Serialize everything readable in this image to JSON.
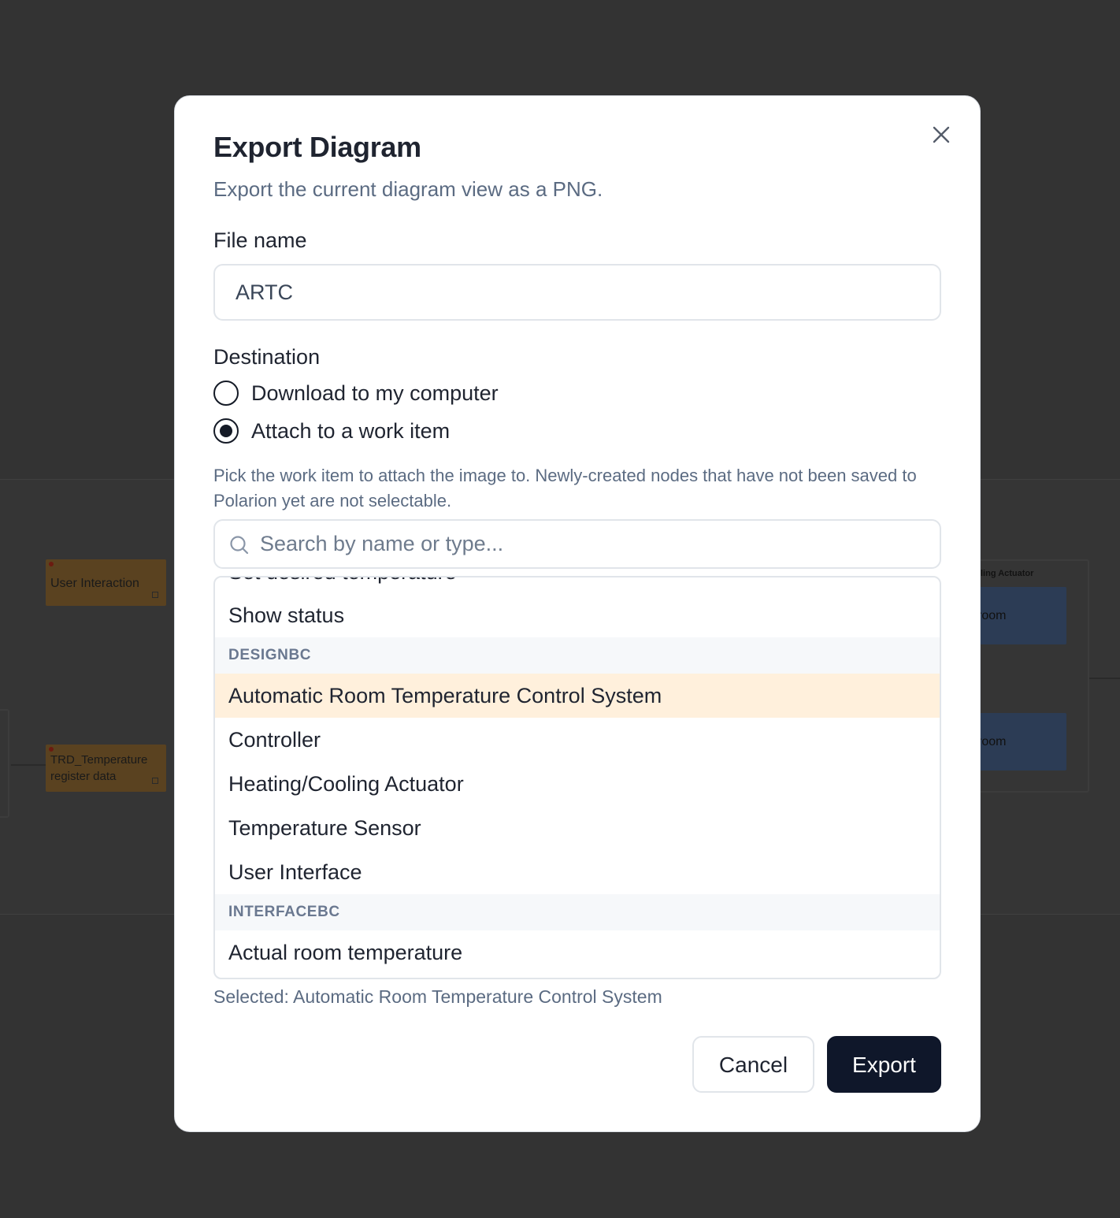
{
  "background": {
    "nodes": [
      {
        "label": "User Interaction"
      },
      {
        "label": "TRD_Temperature register data"
      }
    ],
    "frame_label": "ling Actuator",
    "blue_nodes": [
      "room",
      "room"
    ]
  },
  "dialog": {
    "title": "Export Diagram",
    "subtitle": "Export the current diagram view as a PNG.",
    "file_name_label": "File name",
    "file_name_value": "ARTC",
    "destination_label": "Destination",
    "options": [
      {
        "label": "Download to my computer",
        "checked": false
      },
      {
        "label": "Attach to a work item",
        "checked": true
      }
    ],
    "help_text": "Pick the work item to attach the image to. Newly-created nodes that have not been saved to Polarion yet are not selectable.",
    "search_placeholder": "Search by name or type...",
    "list": {
      "cut_item": "Set desired temperature",
      "rows": [
        {
          "kind": "item",
          "label": "Show status"
        },
        {
          "kind": "group",
          "label": "DESIGNBC"
        },
        {
          "kind": "item",
          "label": "Automatic Room Temperature Control System",
          "selected": true
        },
        {
          "kind": "item",
          "label": "Controller"
        },
        {
          "kind": "item",
          "label": "Heating/Cooling Actuator"
        },
        {
          "kind": "item",
          "label": "Temperature Sensor"
        },
        {
          "kind": "item",
          "label": "User Interface"
        },
        {
          "kind": "group",
          "label": "INTERFACEBC"
        },
        {
          "kind": "item",
          "label": "Actual room temperature"
        }
      ]
    },
    "selected_text": "Selected: Automatic Room Temperature Control System",
    "cancel_label": "Cancel",
    "export_label": "Export"
  },
  "colors": {
    "primary_button": "#0f172a",
    "selected_row": "#fff0dc",
    "muted_text": "#5b6b82"
  }
}
